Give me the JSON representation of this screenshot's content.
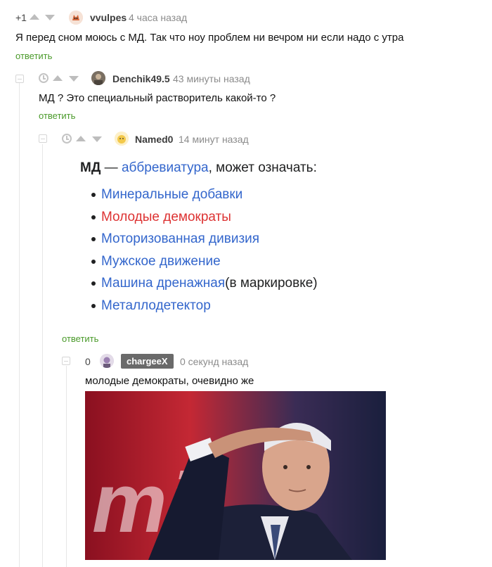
{
  "comments": [
    {
      "rating": "+1",
      "username": "vvulpes",
      "time": "4 часа назад",
      "text": "Я перед сном моюсь с МД. Так что ноу проблем ни вечром ни если надо с утра",
      "reply_label": "ответить"
    },
    {
      "username": "Denchik49.5",
      "time": "43 минуты назад",
      "text": "МД ? Это специальный растворитель какой-то ?",
      "reply_label": "ответить"
    },
    {
      "username": "Named0",
      "time": "14 минут назад",
      "reply_label": "ответить",
      "definition": {
        "term": "МД",
        "dash": " — ",
        "link_word": "аббревиатура",
        "rest": ", может означать:",
        "items": [
          {
            "text": "Минеральные добавки",
            "suffix": "",
            "color": "blue"
          },
          {
            "text": "Молодые демократы",
            "suffix": "",
            "color": "red"
          },
          {
            "text": "Моторизованная дивизия",
            "suffix": "",
            "color": "blue"
          },
          {
            "text": "Мужское движение",
            "suffix": "",
            "color": "blue"
          },
          {
            "text": "Машина дренажная",
            "suffix": " (в маркировке)",
            "color": "blue"
          },
          {
            "text": "Металлодетектор",
            "suffix": "",
            "color": "blue"
          }
        ]
      }
    },
    {
      "rating": "0",
      "username": "chargeeX",
      "time": "0 секунд назад",
      "text": "молодые демократы, очевидно же"
    }
  ],
  "colors": {
    "reply_green": "#4a9a2a",
    "link_blue": "#3366cc",
    "link_red": "#dd3333",
    "chip_gray": "#6a6a6a"
  }
}
